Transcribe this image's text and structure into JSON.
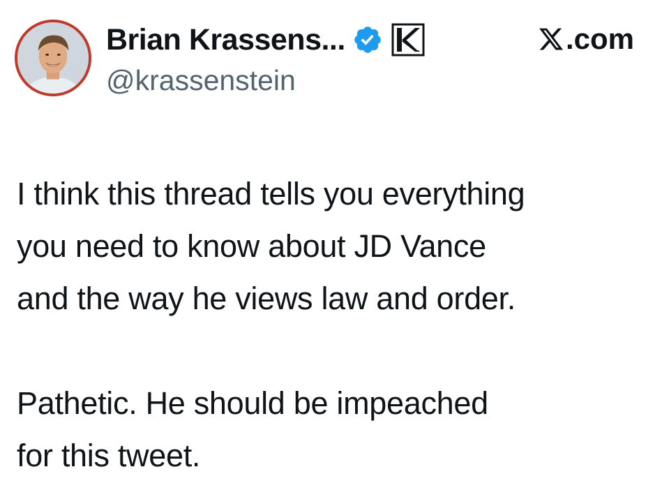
{
  "tweet": {
    "author": {
      "display_name": "Brian Krassens...",
      "handle": "@krassenstein",
      "verified": true,
      "verified_color": "#1d9bf0"
    },
    "source_label": ".com",
    "paragraphs": [
      "I think this thread tells you everything\nyou need to know about JD Vance\nand the way he views law and order.",
      "Pathetic.  He should be impeached\nfor this tweet."
    ]
  }
}
